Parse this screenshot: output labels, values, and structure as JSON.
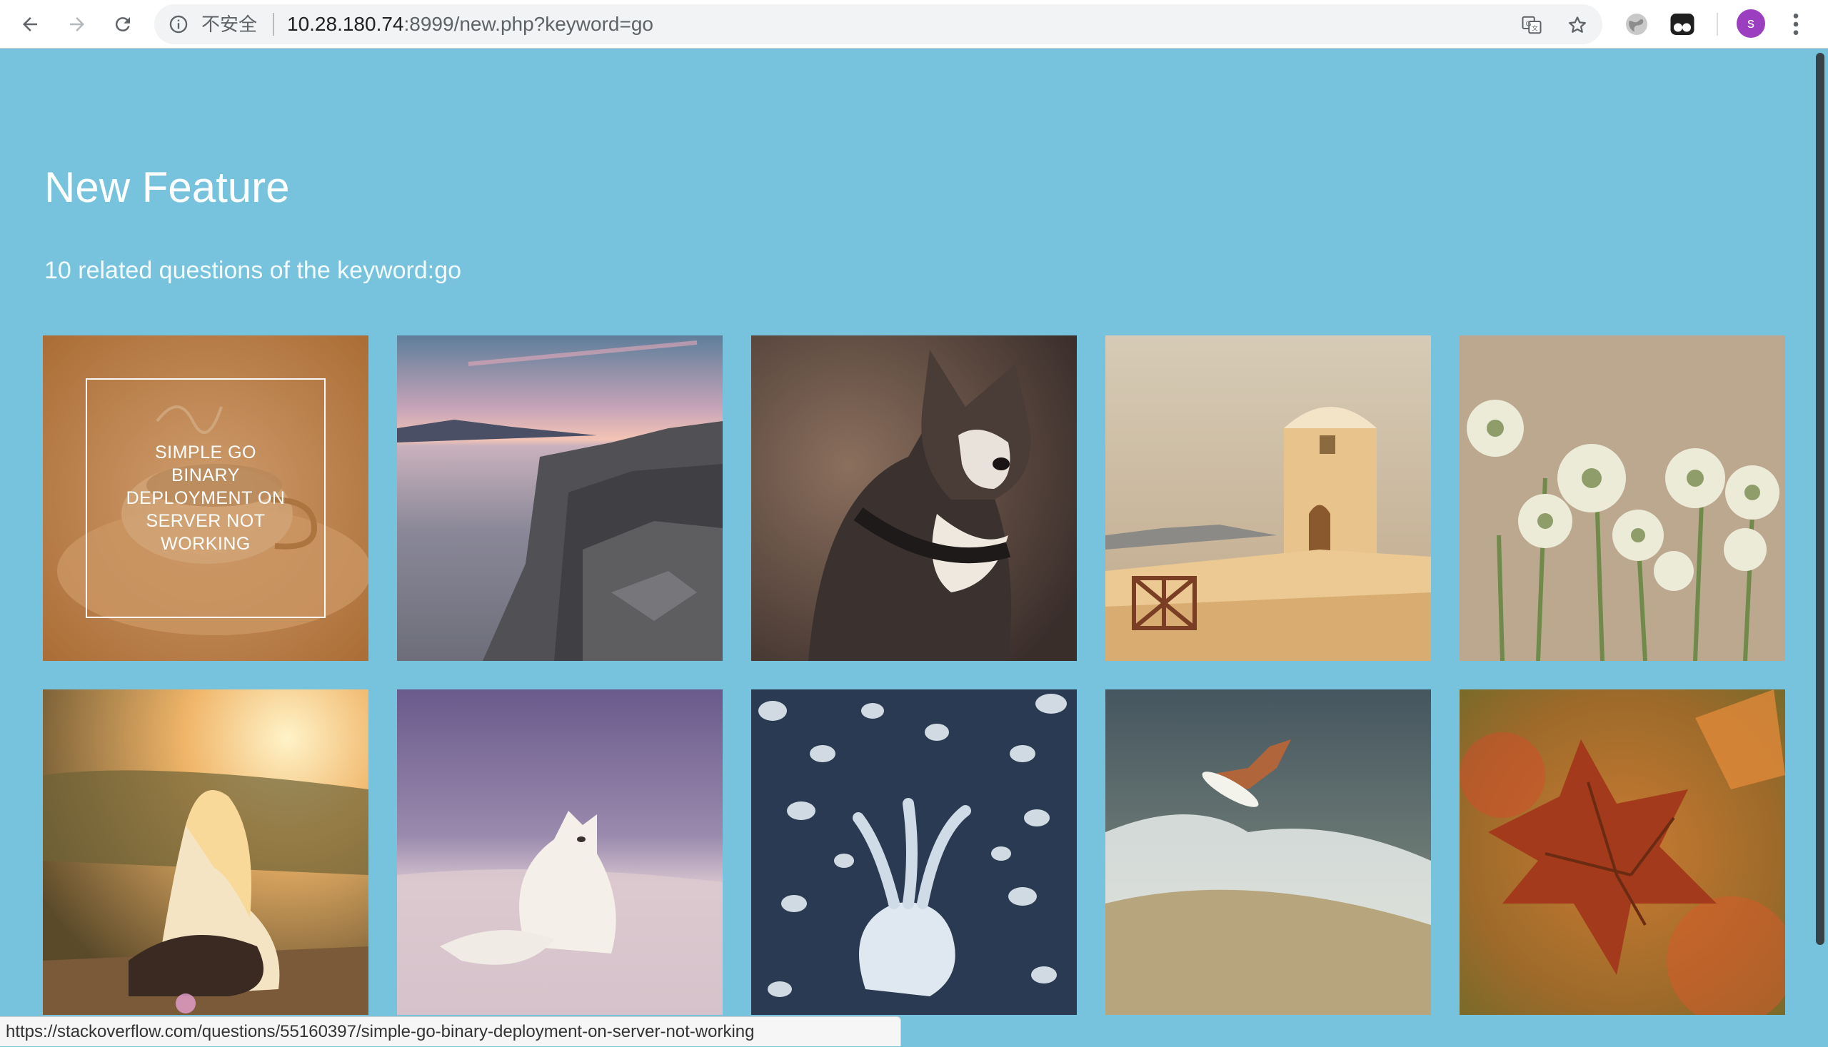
{
  "browser": {
    "security_label": "不安全",
    "url_host": "10.28.180.74",
    "url_rest": ":8999/new.php?keyword=go",
    "profile_initial": "s"
  },
  "page": {
    "title": "New Feature",
    "subtitle": "10 related questions of the keyword:go"
  },
  "tiles": [
    {
      "subject": "coffee cup",
      "overlay_text": "SIMPLE GO BINARY DEPLOYMENT ON SERVER NOT WORKING"
    },
    {
      "subject": "rocky coast at sunset"
    },
    {
      "subject": "husky dog"
    },
    {
      "subject": "whitewashed tower"
    },
    {
      "subject": "white flowers"
    },
    {
      "subject": "woman in sunlight"
    },
    {
      "subject": "arctic fox"
    },
    {
      "subject": "jellyfish"
    },
    {
      "subject": "surfer on wave"
    },
    {
      "subject": "autumn leaf"
    }
  ],
  "status_bar": {
    "url": "https://stackoverflow.com/questions/55160397/simple-go-binary-deployment-on-server-not-working"
  }
}
